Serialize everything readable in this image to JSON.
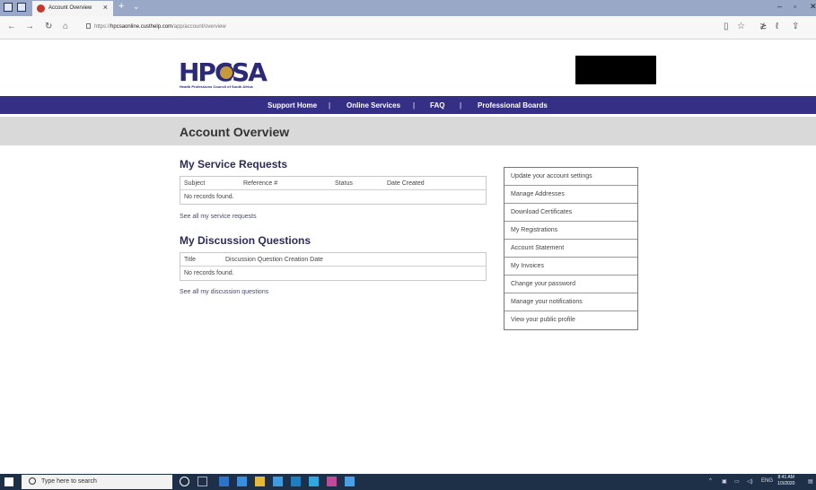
{
  "browser": {
    "tab_title": "Account Overview",
    "url_prefix": "https://",
    "url_host": "hpcsaonline.custhelp.com",
    "url_path": "/app/account/overview"
  },
  "site": {
    "logo_text": "HPCSA",
    "logo_subtitle": "Health Professions Council of South Africa"
  },
  "nav": {
    "items": [
      "Support Home",
      "Online Services",
      "FAQ",
      "Professional Boards"
    ],
    "separator": "|"
  },
  "page": {
    "title": "Account Overview"
  },
  "service_requests": {
    "heading": "My Service Requests",
    "columns": [
      "Subject",
      "Reference #",
      "Status",
      "Date Created"
    ],
    "empty_text": "No records found.",
    "see_all": "See all my service requests"
  },
  "discussion_questions": {
    "heading": "My Discussion Questions",
    "columns": [
      "Title",
      "Discussion Question Creation Date"
    ],
    "empty_text": "No records found.",
    "see_all": "See all my discussion questions"
  },
  "sidebar": {
    "items": [
      "Update your account settings",
      "Manage Addresses",
      "Download Certificates",
      "My Registrations",
      "Account Statement",
      "My Invoices",
      "Change your password",
      "Manage your notifications",
      "View your public profile"
    ]
  },
  "taskbar": {
    "search_placeholder": "Type here to search",
    "language": "ENG",
    "time": "8:41 AM",
    "date": "1/3/2020"
  },
  "colors": {
    "nav_bar": "#352f86",
    "title_bar": "#d9d9d9",
    "logo": "#2a2a78",
    "taskbar": "#1e2f48"
  }
}
